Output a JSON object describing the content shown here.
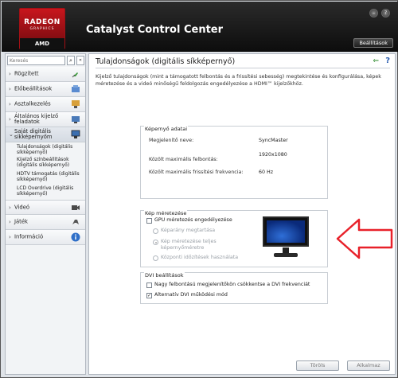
{
  "header": {
    "logo_line1": "RADEON",
    "logo_line2": "GRAPHICS",
    "logo_line3": "AMD",
    "app_title": "Catalyst Control Center",
    "settings_label": "Beállítások"
  },
  "sidebar": {
    "search_placeholder": "Keresés",
    "search_icon": "magnifier-icon",
    "collapse_icon": "double-chevron-left",
    "items": [
      {
        "label": "Rögzített",
        "icon": "pin-icon"
      },
      {
        "label": "Előbeállítások",
        "icon": "presets-icon"
      },
      {
        "label": "Asztalkezelés",
        "icon": "desktop-icon"
      },
      {
        "label": "Általános kijelző feladatok",
        "icon": "display-tasks-icon"
      },
      {
        "label": "Saját digitális síkképernyőm",
        "icon": "flat-panel-icon"
      },
      {
        "label": "Videó",
        "icon": "video-icon"
      },
      {
        "label": "Játék",
        "icon": "gaming-icon"
      },
      {
        "label": "Információ",
        "icon": "info-icon"
      }
    ],
    "sub_items": [
      "Tulajdonságok (digitális síkképernyő)",
      "Kijelző színbeállítások (digitális síkképernyő)",
      "HDTV támogatás (digitális síkképernyő)",
      "LCD Overdrive (digitális síkképernyő)"
    ]
  },
  "main": {
    "title": "Tulajdonságok (digitális síkképernyő)",
    "description": "Kijelző tulajdonságok (mint a támogatott felbontás és a frissítési sebesség) megtekintése és konfigurálása, képek méretezése és a videó minőségű feldolgozás engedélyezése a HDMI™ kijelzőkhöz.",
    "display_data": {
      "title": "Képernyő adatai",
      "rows": [
        {
          "label": "Megjelenítő neve:",
          "value": "SyncMaster"
        },
        {
          "label": "Közölt maximális felbontás:",
          "value": "1920x1080"
        },
        {
          "label": "Közölt maximális frissítési frekvencia:",
          "value": "60 Hz"
        }
      ]
    },
    "scaling": {
      "title": "Kép méretezése",
      "gpu_scaling_label": "GPU méretezés engedélyezése",
      "gpu_scaling_checked": false,
      "options": [
        "Képarány megtartása",
        "Kép méretezése teljes képernyőméretre",
        "Központi időzítések használata"
      ],
      "selected_option": 1
    },
    "dvi": {
      "title": "DVI beállítások",
      "options": [
        {
          "label": "Nagy felbontású megjelenítőkön csökkentse a DVI frekvenciát",
          "checked": false
        },
        {
          "label": "Alternatív DVI működési mód",
          "checked": true
        }
      ]
    },
    "buttons": {
      "discard": "Töröls",
      "apply": "Alkalmaz"
    }
  },
  "colors": {
    "accent_red": "#c8161d",
    "arrow_red": "#e8212a",
    "header_bg": "#1a1a1a"
  }
}
